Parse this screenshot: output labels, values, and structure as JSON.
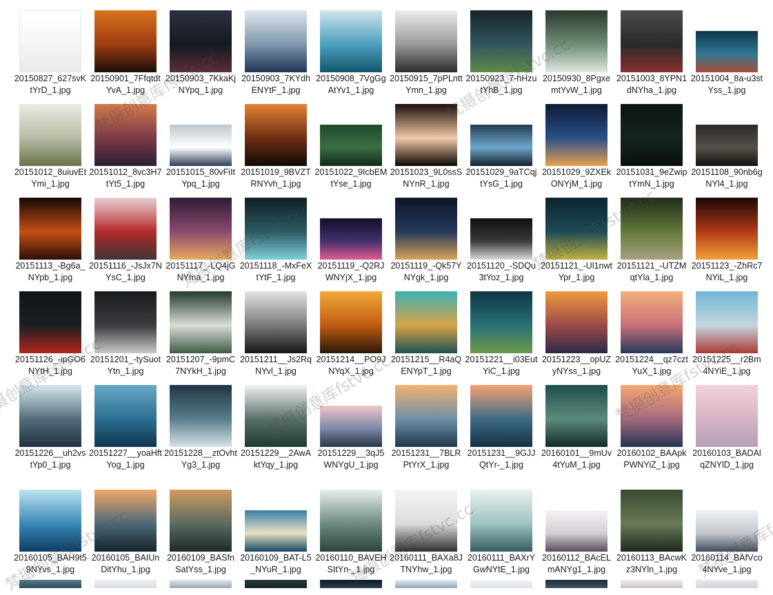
{
  "files": [
    {
      "name": "20150827_627svKtYrD_1.jpg",
      "shape": "p",
      "colors": [
        "#ffffff",
        "#f6f6f6",
        "#e8e8e8"
      ]
    },
    {
      "name": "20150901_7FfqtdtYvA_1.jpg",
      "shape": "p",
      "colors": [
        "#d9731e",
        "#9e3d12",
        "#1a0d07"
      ]
    },
    {
      "name": "20150903_7KkaKjNYpq_1.jpg",
      "shape": "p",
      "colors": [
        "#2b3140",
        "#151922",
        "#5b2e38"
      ]
    },
    {
      "name": "20150903_7KYdhENYtF_1.jpg",
      "shape": "p",
      "colors": [
        "#dfe7ee",
        "#7f97ad",
        "#1f3655"
      ]
    },
    {
      "name": "20150908_7VgGgAtYv1_1.jpg",
      "shape": "p",
      "colors": [
        "#cfe5ee",
        "#4d9fbd",
        "#11566b"
      ]
    },
    {
      "name": "20150915_7pPLnttYmn_1.jpg",
      "shape": "p",
      "colors": [
        "#ececec",
        "#9a9a9a",
        "#2b2b2b"
      ]
    },
    {
      "name": "20150923_7-hHzutYhB_1.jpg",
      "shape": "p",
      "colors": [
        "#15242a",
        "#335560",
        "#5f8a4a"
      ]
    },
    {
      "name": "20150930_8PgxemtYvW_1.jpg",
      "shape": "p",
      "colors": [
        "#2a3a2e",
        "#6e8d76",
        "#dfe8e2"
      ]
    },
    {
      "name": "20151003_8YPN1dNYha_1.jpg",
      "shape": "p",
      "colors": [
        "#4c4c4c",
        "#2a2a2a",
        "#8a3030"
      ]
    },
    {
      "name": "20151004_8a-u3stYss_1.jpg",
      "shape": "l",
      "colors": [
        "#0e3449",
        "#2f7894",
        "#a84e3a"
      ]
    },
    {
      "name": "20151012_8uiuvEtYmi_1.jpg",
      "shape": "p",
      "colors": [
        "#e8ece4",
        "#b7bca4",
        "#68734c"
      ]
    },
    {
      "name": "20151012_8vc3H7tYt5_1.jpg",
      "shape": "p",
      "colors": [
        "#d27a4c",
        "#7c3a46",
        "#2a1f35"
      ]
    },
    {
      "name": "20151015_80vFiItYpq_1.jpg",
      "shape": "l",
      "colors": [
        "#bfc6cf",
        "#ffffff",
        "#2f3f55"
      ]
    },
    {
      "name": "20151019_9BVZTRNYvh_1.jpg",
      "shape": "p",
      "colors": [
        "#e68232",
        "#6e2e12",
        "#120a06"
      ]
    },
    {
      "name": "20151022_9IcbEMtYse_1.jpg",
      "shape": "l",
      "colors": [
        "#204a2c",
        "#3a6f44",
        "#13281a"
      ]
    },
    {
      "name": "20151023_9L0ssSNYnR_1.jpg",
      "shape": "p",
      "colors": [
        "#1a0f0a",
        "#f2c8a8",
        "#0a0604"
      ]
    },
    {
      "name": "20151029_9aTCqjtYsG_1.jpg",
      "shape": "l",
      "colors": [
        "#233c52",
        "#6da6c9",
        "#13212e"
      ]
    },
    {
      "name": "20151029_9ZXEkONYjM_1.jpg",
      "shape": "p",
      "colors": [
        "#0e1c35",
        "#2a4f88",
        "#e7a052"
      ]
    },
    {
      "name": "20151031_9eZwiptYmN_1.jpg",
      "shape": "p",
      "colors": [
        "#0c1512",
        "#15241e",
        "#0a0f0d"
      ]
    },
    {
      "name": "20151108_90nb6gNYl4_1.jpg",
      "shape": "l",
      "colors": [
        "#2c2a28",
        "#555149",
        "#141313"
      ]
    },
    {
      "name": "20151113_-Bg6a_NYpb_1.jpg",
      "shape": "p",
      "colors": [
        "#150806",
        "#c54f16",
        "#2b0f09"
      ]
    },
    {
      "name": "20151116_-JsJx7NYsC_1.jpg",
      "shape": "p",
      "colors": [
        "#e9d1d5",
        "#b32a2a",
        "#3f3535"
      ]
    },
    {
      "name": "20151117_-LQ4jGNYma_1.jpg",
      "shape": "p",
      "colors": [
        "#2d1d35",
        "#8c4b6f",
        "#e7a860"
      ]
    },
    {
      "name": "20151118_-MxFeXtYtF_1.jpg",
      "shape": "p",
      "colors": [
        "#121f24",
        "#2d5a63",
        "#7fd0d8"
      ]
    },
    {
      "name": "20151119_-Q2RJWNYjX_1.jpg",
      "shape": "l",
      "colors": [
        "#160e28",
        "#43306d",
        "#e05c8e"
      ]
    },
    {
      "name": "20151119_-Qk57YNYgk_1.jpg",
      "shape": "p",
      "colors": [
        "#0c1728",
        "#26395b",
        "#d9a35a"
      ]
    },
    {
      "name": "20151120_-SDQu3tYoz_1.jpg",
      "shape": "l",
      "colors": [
        "#101010",
        "#3a3a3a",
        "#d8d8d8"
      ]
    },
    {
      "name": "20151121_-Ul1nwtYpr_1.jpg",
      "shape": "p",
      "colors": [
        "#0b2530",
        "#1d4a57",
        "#c2b13f"
      ]
    },
    {
      "name": "20151121_-UTZMqtYla_1.jpg",
      "shape": "p",
      "colors": [
        "#1f2b1c",
        "#637a3a",
        "#a7a082"
      ]
    },
    {
      "name": "20151123_-ZhRc7NYiL_1.jpg",
      "shape": "p",
      "colors": [
        "#1b0705",
        "#b33b17",
        "#f0a03a"
      ]
    },
    {
      "name": "20151126_-ipGO6NYtH_1.jpg",
      "shape": "p",
      "colors": [
        "#101418",
        "#1b1f24",
        "#b3261b"
      ]
    },
    {
      "name": "20151201_-tySuotYtn_1.jpg",
      "shape": "p",
      "colors": [
        "#1a1b1d",
        "#3b3c3f",
        "#c8c8c8"
      ]
    },
    {
      "name": "20151207_-9pmC7NYkH_1.jpg",
      "shape": "p",
      "colors": [
        "#243a2a",
        "#d8ded8",
        "#405a45"
      ]
    },
    {
      "name": "20151211__Js2RqNYvl_1.jpg",
      "shape": "p",
      "colors": [
        "#e3e3e3",
        "#7a7a7a",
        "#151515"
      ]
    },
    {
      "name": "20151214__PO9JNYqX_1.jpg",
      "shape": "p",
      "colors": [
        "#f2a83a",
        "#c05c12",
        "#2b1808"
      ]
    },
    {
      "name": "20151215__R4aQENYpT_1.jpg",
      "shape": "p",
      "colors": [
        "#3fb0b3",
        "#d7a34a",
        "#1e5052"
      ]
    },
    {
      "name": "20151221__i03EutYiC_1.jpg",
      "shape": "p",
      "colors": [
        "#0d3742",
        "#2a6f78",
        "#6d9a4a"
      ]
    },
    {
      "name": "20151223__opUZyNYss_1.jpg",
      "shape": "p",
      "colors": [
        "#ef9a3d",
        "#9c4a4a",
        "#2b2a46"
      ]
    },
    {
      "name": "20151224__qz7cztYuX_1.jpg",
      "shape": "p",
      "colors": [
        "#f2b07a",
        "#c9707a",
        "#28395a"
      ]
    },
    {
      "name": "20151225__r2Bm4NYiE_1.jpg",
      "shape": "p",
      "colors": [
        "#6fb6d5",
        "#c4d6de",
        "#a83a35"
      ]
    },
    {
      "name": "20151226__uh2vstYp0_1.jpg",
      "shape": "p",
      "colors": [
        "#d6e7ee",
        "#546d7a",
        "#1f3140"
      ]
    },
    {
      "name": "20151227__yoaHftYog_1.jpg",
      "shape": "p",
      "colors": [
        "#6aa9c7",
        "#2c6f92",
        "#0f3550"
      ]
    },
    {
      "name": "20151228__ztOvhtYg3_1.jpg",
      "shape": "p",
      "colors": [
        "#1f3543",
        "#5a7e8c",
        "#d5e2e6"
      ]
    },
    {
      "name": "20151229__2AwAktYqy_1.jpg",
      "shape": "p",
      "colors": [
        "#f0f3f4",
        "#59706b",
        "#1e3a2f"
      ]
    },
    {
      "name": "20151229__3qJ5WNYgU_1.jpg",
      "shape": "l",
      "colors": [
        "#f1c6c8",
        "#7b8aa8",
        "#283646"
      ]
    },
    {
      "name": "20151231__7BLRPtYrX_1.jpg",
      "shape": "p",
      "colors": [
        "#f0b272",
        "#6e8fa6",
        "#1d3a4b"
      ]
    },
    {
      "name": "20151231__9GJJQtYr-_1.jpg",
      "shape": "p",
      "colors": [
        "#f3a272",
        "#3e6b87",
        "#163042"
      ]
    },
    {
      "name": "20160101__9mUv4tYuM_1.jpg",
      "shape": "p",
      "colors": [
        "#1f4e4d",
        "#5c8b7c",
        "#0f2a2b"
      ]
    },
    {
      "name": "20160102_BAApkPWNYiZ_1.jpg",
      "shape": "p",
      "colors": [
        "#f4a870",
        "#a46a7f",
        "#233450"
      ]
    },
    {
      "name": "20160103_BADAlqZNYlD_1.jpg",
      "shape": "p",
      "colors": [
        "#f2d2d9",
        "#d7b4c4",
        "#b5a0b9"
      ]
    },
    {
      "name": "20160105_BAH9t59NYvs_1.jpg",
      "shape": "p",
      "colors": [
        "#bfe4f1",
        "#3b88b8",
        "#0e3d63"
      ]
    },
    {
      "name": "20160105_BAIUnDitYhu_1.jpg",
      "shape": "p",
      "colors": [
        "#f2a767",
        "#4d6a78",
        "#13232c"
      ]
    },
    {
      "name": "20160109_BASfnSatYss_1.jpg",
      "shape": "p",
      "colors": [
        "#d19a5e",
        "#5a6b60",
        "#1e2b2a"
      ]
    },
    {
      "name": "20160109_BAT-L5_NYuR_1.jpg",
      "shape": "l",
      "colors": [
        "#3a7fa2",
        "#e8e2c5",
        "#124862"
      ]
    },
    {
      "name": "20160110_BAVEHSItYn-_1.jpg",
      "shape": "p",
      "colors": [
        "#e8eeee",
        "#6f8a80",
        "#2c4438"
      ]
    },
    {
      "name": "20160111_BAXa8JTNYhw_1.jpg",
      "shape": "p",
      "colors": [
        "#f4f4f4",
        "#dcdcdc",
        "#2f2f2f"
      ]
    },
    {
      "name": "20160111_BAXrYGwNYtE_1.jpg",
      "shape": "p",
      "colors": [
        "#e8f1f1",
        "#9fc2c3",
        "#355c5f"
      ]
    },
    {
      "name": "20160112_BAcELmANYg1_1.jpg",
      "shape": "l",
      "colors": [
        "#f6f0f3",
        "#d6cfd6",
        "#5a4c5d"
      ]
    },
    {
      "name": "20160113_BAcwKz3NYln_1.jpg",
      "shape": "p",
      "colors": [
        "#3a4a34",
        "#6a7a55",
        "#1e2a1c"
      ]
    },
    {
      "name": "20160114_BAfVco4NYve_1.jpg",
      "shape": "l",
      "colors": [
        "#f1f1f3",
        "#c3c7cf",
        "#40505a"
      ]
    }
  ],
  "partial_row": [
    {
      "colors": [
        "#5a7f8f",
        "#2e4a56"
      ]
    },
    {
      "colors": [
        "#f0f0f2",
        "#d8dce3"
      ]
    },
    {
      "colors": [
        "#e3e7ea",
        "#9aa8b2"
      ]
    },
    {
      "colors": [
        "#2a3a3d",
        "#16201f"
      ]
    },
    {
      "colors": [
        "#0f1b22",
        "#284051"
      ]
    },
    {
      "colors": [
        "#e6ecf0",
        "#8fa5b7"
      ]
    },
    {
      "colors": [
        "#f4f4f5",
        "#dfe2e6"
      ]
    },
    {
      "colors": [
        "#1f2b36",
        "#3c566a"
      ]
    },
    {
      "colors": [
        "#f0eef0",
        "#c9c3c8"
      ]
    },
    {
      "colors": [
        "#e9e9eb",
        "#cfd3d8"
      ]
    }
  ],
  "watermark": "梵摄创意库fstvc.cc"
}
